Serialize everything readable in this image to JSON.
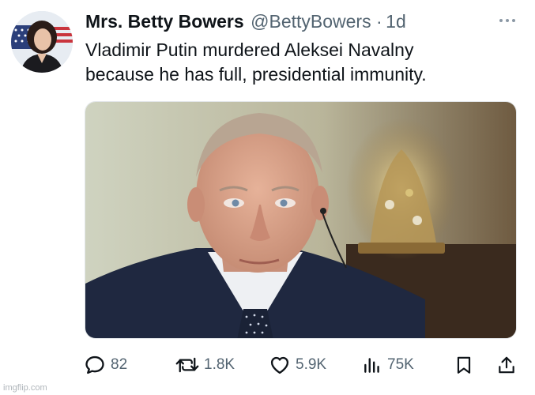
{
  "tweet": {
    "author_name": "Mrs. Betty Bowers",
    "handle": "@BettyBowers",
    "separator": "·",
    "time": "1d",
    "text_line1": "Vladimir Putin murdered Aleksei Navalny",
    "text_line2": "because he has full, presidential immunity.",
    "media": {
      "description_icon": "photo"
    }
  },
  "actions": {
    "replies": "82",
    "reposts": "1.8K",
    "likes": "5.9K",
    "views": "75K"
  },
  "icons": {
    "reply": "reply-icon",
    "repost": "repost-icon",
    "like": "heart-icon",
    "views": "views-icon",
    "bookmark": "bookmark-icon",
    "share": "share-icon",
    "more": "more-icon"
  },
  "colors": {
    "text": "#0f1419",
    "secondary": "#536471"
  },
  "watermark": "imgflip.com"
}
